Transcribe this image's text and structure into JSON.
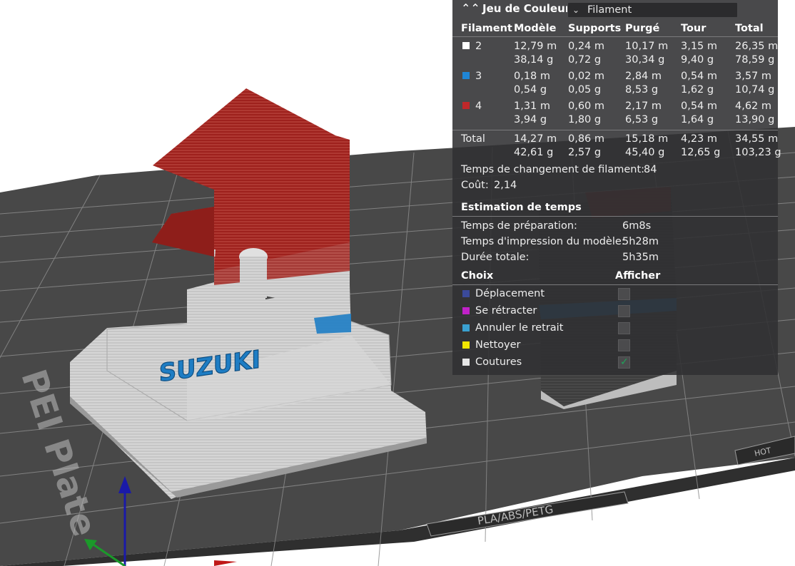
{
  "panel": {
    "title": "Jeu de Couleur",
    "view_mode": "Filament",
    "columns": [
      "Filament",
      "Modèle",
      "Supports",
      "Purgé",
      "Tour",
      "Total"
    ],
    "filaments": [
      {
        "id": "2",
        "color": "#ffffff",
        "model": [
          "12,79 m",
          "38,14 g"
        ],
        "supports": [
          "0,24 m",
          "0,72 g"
        ],
        "purge": [
          "10,17 m",
          "30,34 g"
        ],
        "tower": [
          "3,15 m",
          "9,40 g"
        ],
        "total": [
          "26,35 m",
          "78,59 g"
        ]
      },
      {
        "id": "3",
        "color": "#1f86d6",
        "model": [
          "0,18 m",
          "0,54 g"
        ],
        "supports": [
          "0,02 m",
          "0,05 g"
        ],
        "purge": [
          "2,84 m",
          "8,53 g"
        ],
        "tower": [
          "0,54 m",
          "1,62 g"
        ],
        "total": [
          "3,57 m",
          "10,74 g"
        ]
      },
      {
        "id": "4",
        "color": "#c0282a",
        "model": [
          "1,31 m",
          "3,94 g"
        ],
        "supports": [
          "0,60 m",
          "1,80 g"
        ],
        "purge": [
          "2,17 m",
          "6,53 g"
        ],
        "tower": [
          "0,54 m",
          "1,64 g"
        ],
        "total": [
          "4,62 m",
          "13,90 g"
        ]
      }
    ],
    "totals": {
      "label": "Total",
      "model": [
        "14,27 m",
        "42,61 g"
      ],
      "supports": [
        "0,86 m",
        "2,57 g"
      ],
      "purge": [
        "15,18 m",
        "45,40 g"
      ],
      "tower": [
        "4,23 m",
        "12,65 g"
      ],
      "total": [
        "34,55 m",
        "103,23 g"
      ]
    },
    "change_time": {
      "label": "Temps de changement de filament:",
      "value": "84"
    },
    "cost": {
      "label": "Coût:",
      "value": "2,14"
    },
    "time_estimate": {
      "title": "Estimation de temps",
      "rows": [
        {
          "label": "Temps de préparation:",
          "value": "6m8s"
        },
        {
          "label": "Temps d'impression du modèle:",
          "value": "5h28m"
        },
        {
          "label": "Durée totale:",
          "value": "5h35m"
        }
      ]
    },
    "options": {
      "header_choice": "Choix",
      "header_show": "Afficher",
      "items": [
        {
          "label": "Déplacement",
          "color": "#3b4a9a",
          "checked": false
        },
        {
          "label": "Se rétracter",
          "color": "#c021c8",
          "checked": false
        },
        {
          "label": "Annuler le retrait",
          "color": "#3aa0d0",
          "checked": false
        },
        {
          "label": "Nettoyer",
          "color": "#f2e600",
          "checked": false
        },
        {
          "label": "Coutures",
          "color": "#e6e6e6",
          "checked": true
        }
      ]
    }
  },
  "plate": {
    "label": "PEI Plate",
    "bottom_label": "PLA/ABS/PETG",
    "right_label": "HOT",
    "model_text": "SUZUKI"
  },
  "colors": {
    "plate": "#4a4a4a",
    "grid": "#8a8a8a",
    "model_white": "#cfcfcf",
    "model_red": "#a8231f",
    "model_blue": "#1e7dc4"
  }
}
